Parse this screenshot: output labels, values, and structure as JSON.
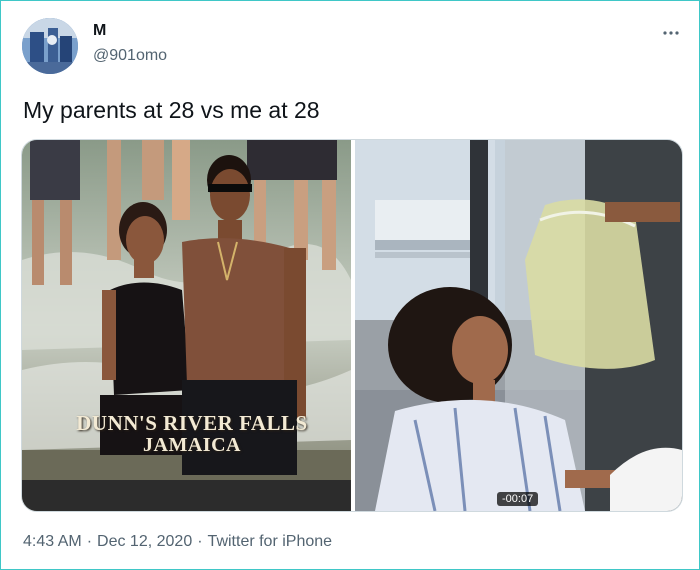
{
  "tweet": {
    "author_name": "M",
    "author_handle": "@901omo",
    "more_icon": "more-horizontal-icon",
    "text": "My parents at 28 vs me at 28",
    "media": {
      "left_photo_caption_line1": "DUNN'S RIVER FALLS",
      "left_photo_caption_line2": "JAMAICA",
      "video_timer": "-00:07"
    },
    "meta": {
      "time": "4:43 AM",
      "separator": "·",
      "date": "Dec 12, 2020",
      "source": "Twitter for iPhone"
    }
  },
  "colors": {
    "border_accent": "#3fc7c7",
    "secondary_text": "#536471",
    "primary_text": "#0f1419"
  }
}
